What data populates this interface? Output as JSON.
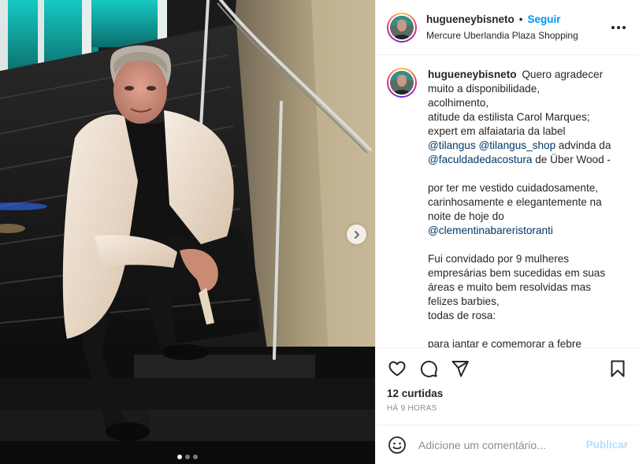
{
  "post": {
    "image_alt": "Homem sentado em escada de mármore preto com blazer bege",
    "carousel": {
      "current": 1,
      "total": 3
    }
  },
  "header": {
    "username": "hugueneybisneto",
    "separator": "•",
    "follow_label": "Seguir",
    "location": "Mercure Uberlandia Plaza Shopping",
    "more_icon": "more-horizontal-icon"
  },
  "caption": {
    "username": "hugueneybisneto",
    "lines": {
      "l1": "Quero agradecer",
      "l2": "muito a disponibilidade,",
      "l3": "acolhimento,",
      "l4": "atitude da estilista Carol Marques;",
      "l5": "expert em alfaiataria da label",
      "m1": "@tilangus",
      "m2": "@tilangus_shop",
      "l6": " advinda da",
      "m3": "@faculdadedacostura",
      "l7": " de Über Wood -",
      "l8": "por ter me vestido cuidadosamente,",
      "l9": "carinhosamente e elegantemente na",
      "l10": "noite de hoje do",
      "m4": "@clementinabareristoranti",
      "l11": "Fui convidado por 9 mulheres",
      "l12": "empresárias bem sucedidas em suas",
      "l13": "áreas e muito bem resolvidas mas",
      "l14": "felizes barbies,",
      "l15": "todas de rosa:",
      "l16": "para jantar e comemorar a febre"
    }
  },
  "actions": {
    "like_icon": "heart-icon",
    "comment_icon": "comment-icon",
    "share_icon": "send-icon",
    "save_icon": "bookmark-icon",
    "likes_label": "12 curtidas",
    "time_label": "HÁ 9 HORAS"
  },
  "comment": {
    "emoji_icon": "emoji-icon",
    "placeholder": "Adicione um comentário...",
    "publish_label": "Publicar"
  },
  "colors": {
    "accent": "#0095f6",
    "mention": "#00376b",
    "publish_disabled": "#b2dffc",
    "muted": "#8e8e8e"
  }
}
